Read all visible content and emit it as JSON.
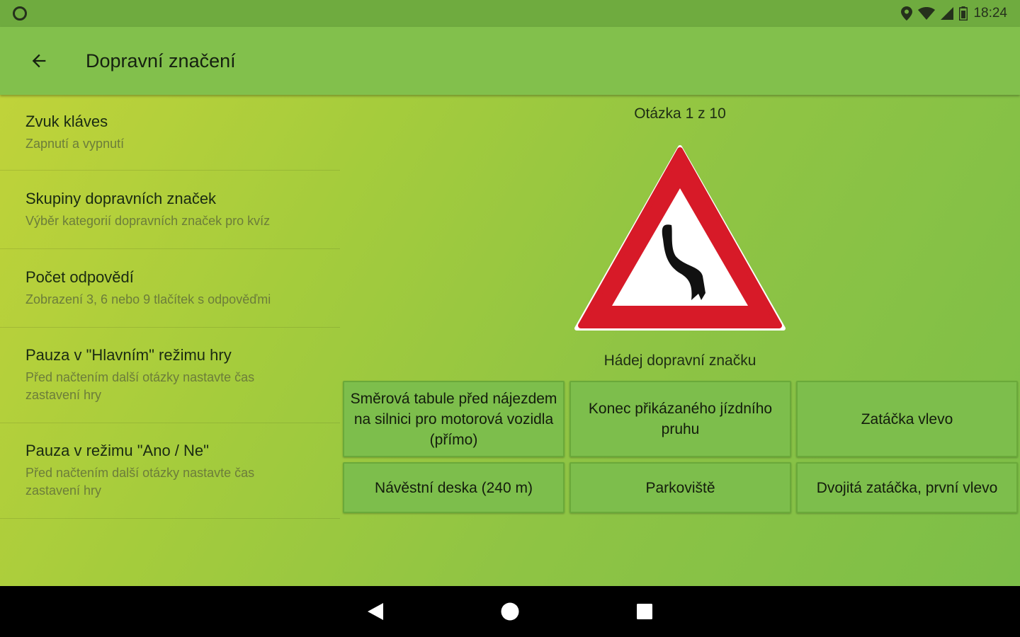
{
  "status_bar": {
    "time": "18:24"
  },
  "app_bar": {
    "title": "Dopravní značení"
  },
  "settings": [
    {
      "title": "Zvuk kláves",
      "subtitle": "Zapnutí a vypnutí"
    },
    {
      "title": "Skupiny dopravních značek",
      "subtitle": "Výběr kategorií dopravních značek pro kvíz"
    },
    {
      "title": "Počet odpovědí",
      "subtitle": "Zobrazení 3, 6 nebo 9 tlačítek s odpověďmi"
    },
    {
      "title": "Pauza v \"Hlavním\" režimu hry",
      "subtitle": "Před načtením další otázky nastavte čas zastavení hry"
    },
    {
      "title": "Pauza v režimu \"Ano / Ne\"",
      "subtitle": "Před načtením další otázky nastavte čas zastavení hry"
    }
  ],
  "quiz": {
    "counter": "Otázka 1 z 10",
    "prompt": "Hádej dopravní značku",
    "sign_icon": "double-bend-first-left-warning-sign",
    "answers": [
      "Směrová tabule před nájezdem na silnici pro motorová vozidla (přímo)",
      "Konec přikázaného jízdního pruhu",
      "Zatáčka vlevo",
      "Návěstní deska (240 m)",
      "Parkoviště",
      "Dvojitá zatáčka, první vlevo"
    ]
  },
  "colors": {
    "status_bar": "#6fab3f",
    "app_bar": "#82c04c",
    "button": "#7dbe4c",
    "sign_red": "#d71a28"
  }
}
